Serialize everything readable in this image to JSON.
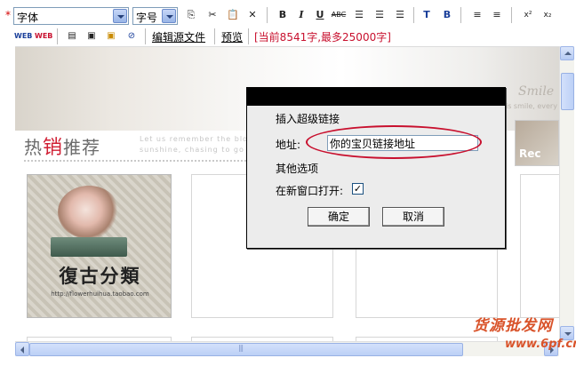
{
  "toolbar": {
    "required_mark": "*",
    "font_family": "字体",
    "font_size": "字号"
  },
  "toolbar2": {
    "edit_source": "编辑源文件",
    "preview": "预览",
    "char_count": "[当前8541字,最多25000字]"
  },
  "content": {
    "banner_brand": "Smile",
    "banner_sub": "is smile, every",
    "section_title_a": "热",
    "section_title_b": "销",
    "section_title_c": "推荐",
    "section_sub": "Let us remember the blo persistent! Do not you s sunshine, chasing to go",
    "thumb_label": "Rec",
    "product_title": "復古分類",
    "product_url": "http://flowerhuihua.taobao.com"
  },
  "dialog": {
    "heading": "插入超级链接",
    "address_label": "地址:",
    "address_value": "你的宝贝链接地址",
    "other_options": "其他选项",
    "new_window_label": "在新窗口打开:",
    "new_window_checked": true,
    "ok": "确定",
    "cancel": "取消"
  },
  "watermark": {
    "line1": "货源批发网",
    "line2": "www.6pf.cn"
  },
  "colors": {
    "accent_red": "#c8102e",
    "watermark": "#d9532a"
  }
}
